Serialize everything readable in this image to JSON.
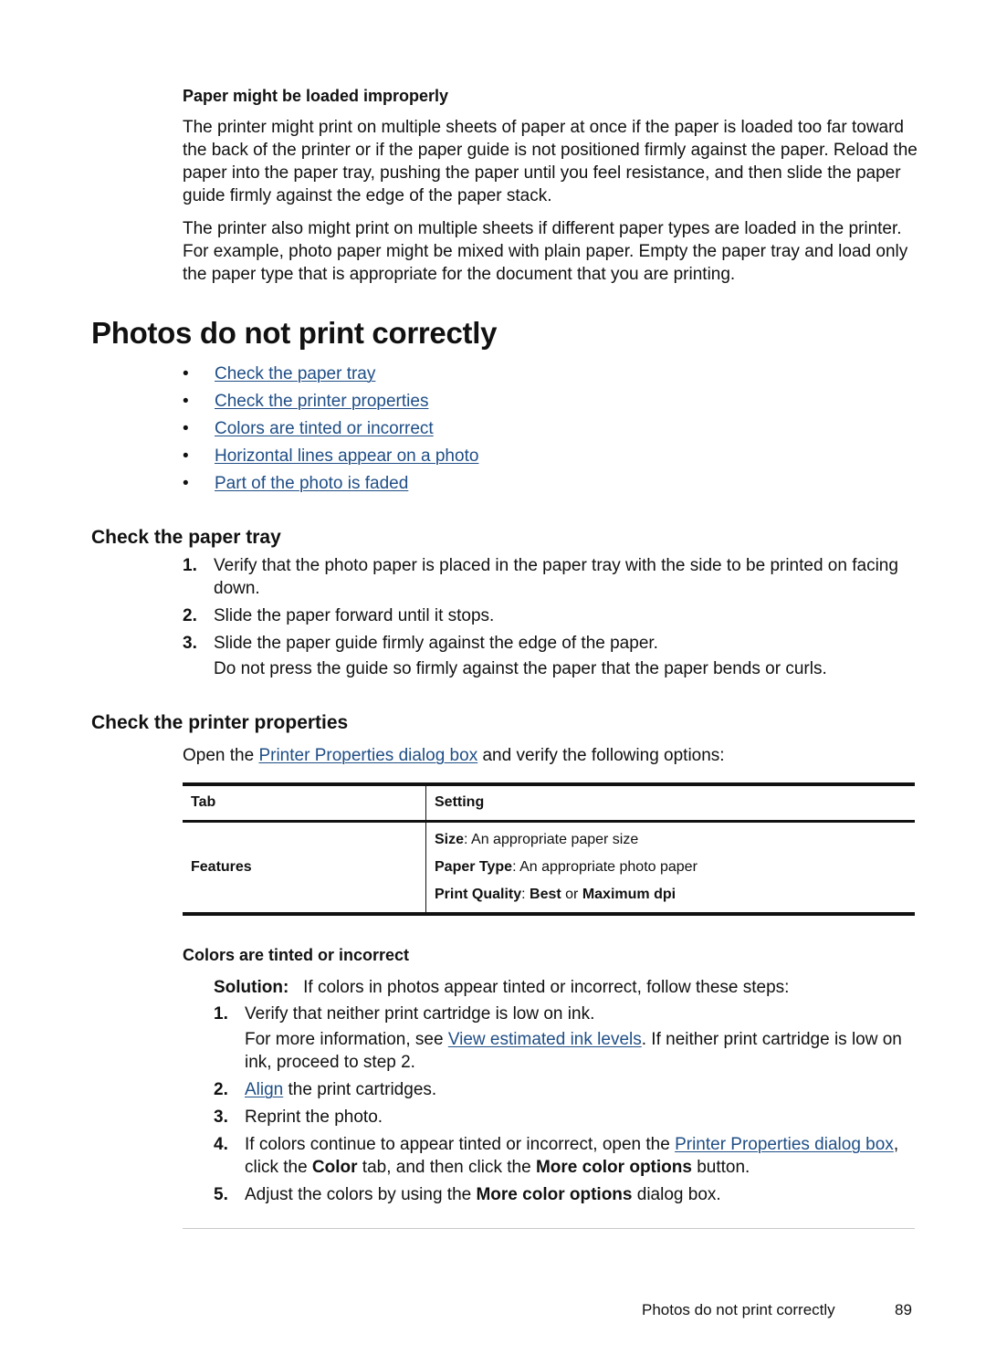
{
  "section_intro": {
    "heading": "Paper might be loaded improperly",
    "paragraphs": [
      "The printer might print on multiple sheets of paper at once if the paper is loaded too far toward the back of the printer or if the paper guide is not positioned firmly against the paper. Reload the paper into the paper tray, pushing the paper until you feel resistance, and then slide the paper guide firmly against the edge of the paper stack.",
      "The printer also might print on multiple sheets if different paper types are loaded in the printer. For example, photo paper might be mixed with plain paper. Empty the paper tray and load only the paper type that is appropriate for the document that you are printing."
    ]
  },
  "page_title": "Photos do not print correctly",
  "toc_links": [
    {
      "bullet": "•",
      "label": "Check the paper tray"
    },
    {
      "bullet": "•",
      "label": "Check the printer properties"
    },
    {
      "bullet": "•",
      "label": "Colors are tinted or incorrect"
    },
    {
      "bullet": "•",
      "label": "Horizontal lines appear on a photo"
    },
    {
      "bullet": "•",
      "label": "Part of the photo is faded"
    }
  ],
  "paper_tray": {
    "heading": "Check the paper tray",
    "steps": [
      {
        "num": "1.",
        "text": "Verify that the photo paper is placed in the paper tray with the side to be printed on facing down."
      },
      {
        "num": "2.",
        "text": "Slide the paper forward until it stops."
      },
      {
        "num": "3.",
        "text": "Slide the paper guide firmly against the edge of the paper.",
        "note": "Do not press the guide so firmly against the paper that the paper bends or curls."
      }
    ]
  },
  "printer_properties": {
    "heading": "Check the printer properties",
    "intro_before": "Open the ",
    "intro_link": "Printer Properties dialog box",
    "intro_after": " and verify the following options:",
    "table": {
      "headers": [
        "Tab",
        "Setting"
      ],
      "row": {
        "tab": "Features",
        "settings": [
          {
            "label": "Size",
            "sep": ": ",
            "value": "An appropriate paper size"
          },
          {
            "label": "Paper Type",
            "sep": ": ",
            "value": "An appropriate photo paper"
          },
          {
            "label": "Print Quality",
            "sep": ": ",
            "value_bold1": "Best",
            "value_mid": " or ",
            "value_bold2": "Maximum dpi"
          }
        ]
      }
    }
  },
  "colors": {
    "heading": "Colors are tinted or incorrect",
    "solution_label": "Solution:",
    "solution_text": "If colors in photos appear tinted or incorrect, follow these steps:",
    "steps": {
      "s1": {
        "num": "1.",
        "text": "Verify that neither print cartridge is low on ink.",
        "note_before": "For more information, see ",
        "note_link": "View estimated ink levels",
        "note_after": ". If neither print cartridge is low on ink, proceed to step 2."
      },
      "s2": {
        "num": "2.",
        "link": "Align",
        "text": " the print cartridges."
      },
      "s3": {
        "num": "3.",
        "text": "Reprint the photo."
      },
      "s4": {
        "num": "4.",
        "before": "If colors continue to appear tinted or incorrect, open the ",
        "link": "Printer Properties dialog box",
        "mid1": ", click the ",
        "bold1": "Color",
        "mid2": " tab, and then click the ",
        "bold2": "More color options",
        "after": " button."
      },
      "s5": {
        "num": "5.",
        "before": "Adjust the colors by using the ",
        "bold": "More color options",
        "after": " dialog box."
      }
    }
  },
  "footer": {
    "section": "Photos do not print correctly",
    "page_number": "89"
  },
  "colors_palette": {
    "link": "#1f4e86",
    "text": "#111111",
    "rule": "#c8c8c8"
  }
}
